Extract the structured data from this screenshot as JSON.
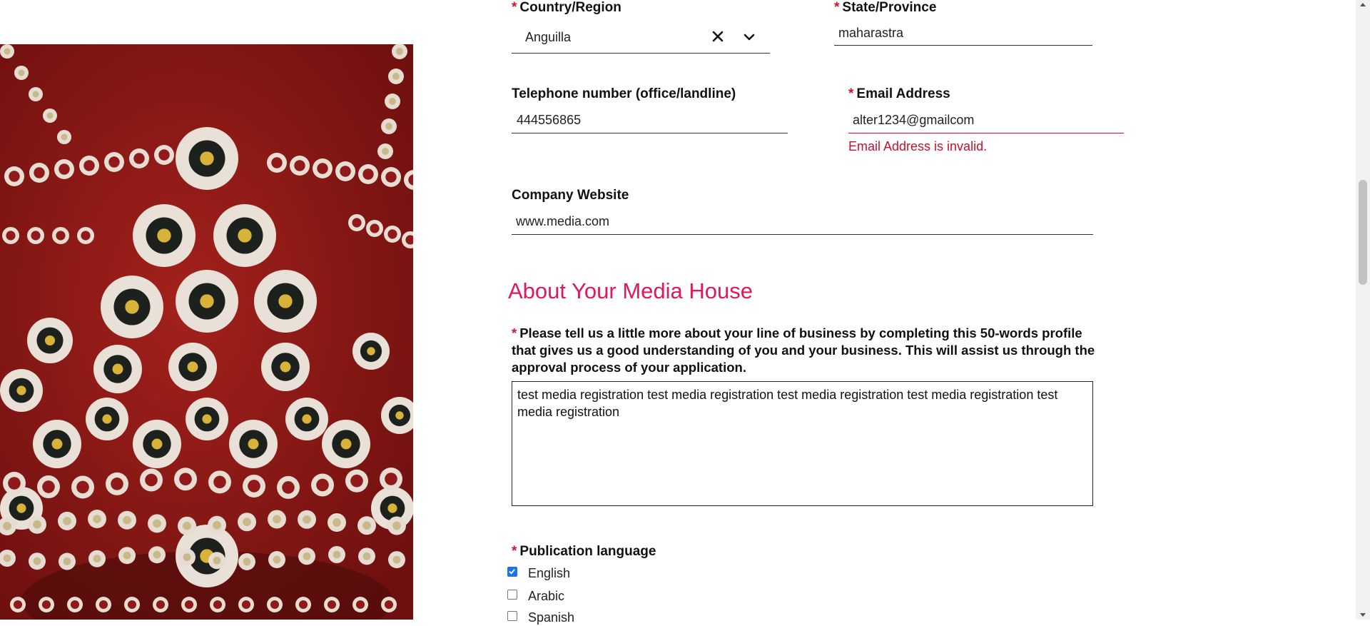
{
  "form": {
    "country": {
      "label": "Country/Region",
      "value": "Anguilla",
      "clear_icon": "close-icon",
      "dropdown_icon": "chevron-down-icon"
    },
    "state": {
      "label": "State/Province",
      "value": "maharastra"
    },
    "telephone": {
      "label": "Telephone number (office/landline)",
      "value": "444556865"
    },
    "email": {
      "label": "Email Address",
      "value": "alter1234@gmailcom",
      "error": "Email Address is invalid."
    },
    "website": {
      "label": "Company Website",
      "value": "www.media.com"
    }
  },
  "about": {
    "heading": "About Your Media House",
    "profile_label": "Please tell us a little more about your line of business by completing this 50-words profile that gives us a good understanding of you and your business. This will assist us through the approval process of your application.",
    "profile_value": "test media registration test media registration test media registration test media registration test media registration"
  },
  "publication": {
    "label": "Publication language",
    "options": [
      {
        "label": "English",
        "checked": true
      },
      {
        "label": "Arabic",
        "checked": false
      },
      {
        "label": "Spanish",
        "checked": false
      }
    ]
  },
  "required_marker": "*",
  "colors": {
    "accent": "#e0185a",
    "error": "#c8102e",
    "required": "#d0142c",
    "checkbox": "#1a73e8"
  }
}
